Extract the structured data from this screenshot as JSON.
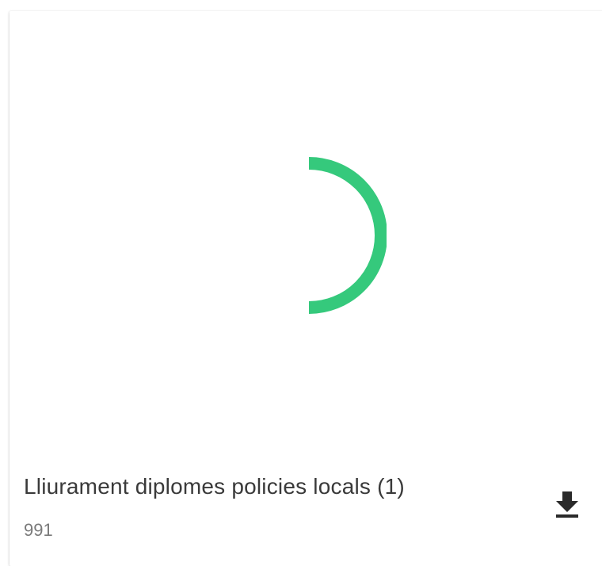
{
  "file": {
    "name": "Lliurament diplomes policies locals (1)",
    "meta": "991"
  },
  "spinner": {
    "color": "#35c97c"
  },
  "icons": {
    "download": "download-icon"
  }
}
